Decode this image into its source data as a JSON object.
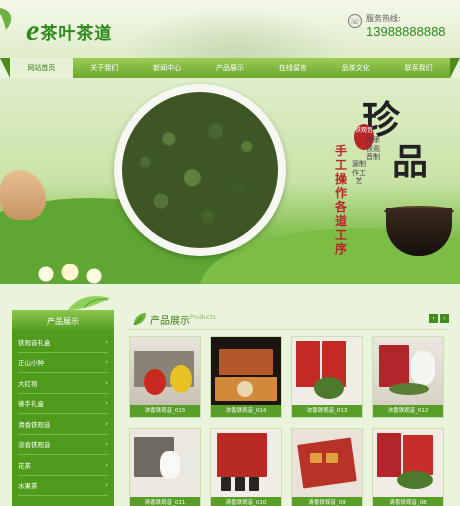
{
  "brand": {
    "logo_letter": "e",
    "logo_text": "茶叶茶道",
    "hotline_label": "服务热线:",
    "hotline_number": "13988888888",
    "accent": "#2f8a1e"
  },
  "nav": {
    "items": [
      {
        "label": "网站首页",
        "active": true
      },
      {
        "label": "关于我们",
        "active": false
      },
      {
        "label": "新闻中心",
        "active": false
      },
      {
        "label": "产品展示",
        "active": false
      },
      {
        "label": "在线留言",
        "active": false
      },
      {
        "label": "品茶文化",
        "active": false
      },
      {
        "label": "联系我们",
        "active": false
      }
    ]
  },
  "banner": {
    "big_char_1": "珍",
    "big_char_2": "品",
    "seal_text": "铁观音",
    "tagline_small_1": "传承铁观音制",
    "tagline_small_2": "源制作工艺",
    "tagline_red_1": "手工",
    "tagline_red_2": "操作",
    "tagline_red_3": "各道",
    "tagline_red_4": "工序"
  },
  "sidebar": {
    "title": "产品展示",
    "items": [
      {
        "label": "铁观音礼盒"
      },
      {
        "label": "正山小种"
      },
      {
        "label": "大红袍"
      },
      {
        "label": "佛手礼盒"
      },
      {
        "label": "清香铁观音"
      },
      {
        "label": "浓香铁观音"
      },
      {
        "label": "花茶"
      },
      {
        "label": "水果茶"
      }
    ]
  },
  "products": {
    "title": "产品展示",
    "subtitle": "Products",
    "prev_icon": "chevron-left-icon",
    "next_icon": "chevron-right-icon",
    "items": [
      {
        "caption": "浓香铁观音_015"
      },
      {
        "caption": "浓香铁观音_014"
      },
      {
        "caption": "浓香铁观音_013"
      },
      {
        "caption": "浓香铁观音_012"
      },
      {
        "caption": "清香铁观音_011"
      },
      {
        "caption": "清香铁观音_010"
      },
      {
        "caption": "清香铁观音_09"
      },
      {
        "caption": "清香铁观音_08"
      }
    ]
  }
}
